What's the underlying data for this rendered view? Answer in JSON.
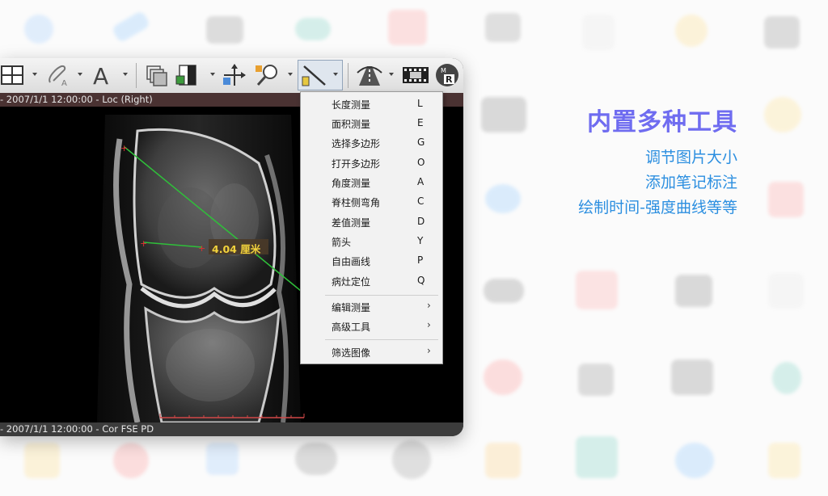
{
  "window": {
    "info_top": "- 2007/1/1 12:00:00 - Loc (Right)",
    "info_bottom": "- 2007/1/1 12:00:00 - Cor FSE PD"
  },
  "toolbar": {
    "icons": [
      "layout-grid-icon",
      "annotation-pen-icon",
      "text-tool-icon",
      "stack-images-icon",
      "window-level-icon",
      "pan-move-icon",
      "zoom-icon",
      "measure-ruler-icon",
      "road-perspective-icon",
      "film-cine-icon",
      "mpr-r-icon"
    ],
    "text_tool_glyph": "A",
    "mpr_glyph": "R"
  },
  "viewer": {
    "measurement_label": "4.04 厘米",
    "measure_color": "#2fbf3a",
    "marker_color": "#e03030",
    "label_color": "#f2d23c"
  },
  "menu": {
    "items": [
      {
        "label": "长度测量",
        "key": "L"
      },
      {
        "label": "面积测量",
        "key": "E"
      },
      {
        "label": "选择多边形",
        "key": "G"
      },
      {
        "label": "打开多边形",
        "key": "O"
      },
      {
        "label": "角度测量",
        "key": "A"
      },
      {
        "label": "脊柱侧弯角",
        "key": "C"
      },
      {
        "label": "差值测量",
        "key": "D"
      },
      {
        "label": "箭头",
        "key": "Y"
      },
      {
        "label": "自由画线",
        "key": "P"
      },
      {
        "label": "病灶定位",
        "key": "Q"
      }
    ],
    "submenus": [
      {
        "label": "编辑测量",
        "arrow": "›"
      },
      {
        "label": "高级工具",
        "arrow": "›"
      },
      {
        "label": "筛选图像",
        "arrow": "›"
      }
    ]
  },
  "promo": {
    "headline": "内置多种工具",
    "lines": [
      "调节图片大小",
      "添加笔记标注",
      "绘制时间-强度曲线等等"
    ],
    "headline_color": "#6f6cf0",
    "line_color": "#2c8fe0"
  }
}
